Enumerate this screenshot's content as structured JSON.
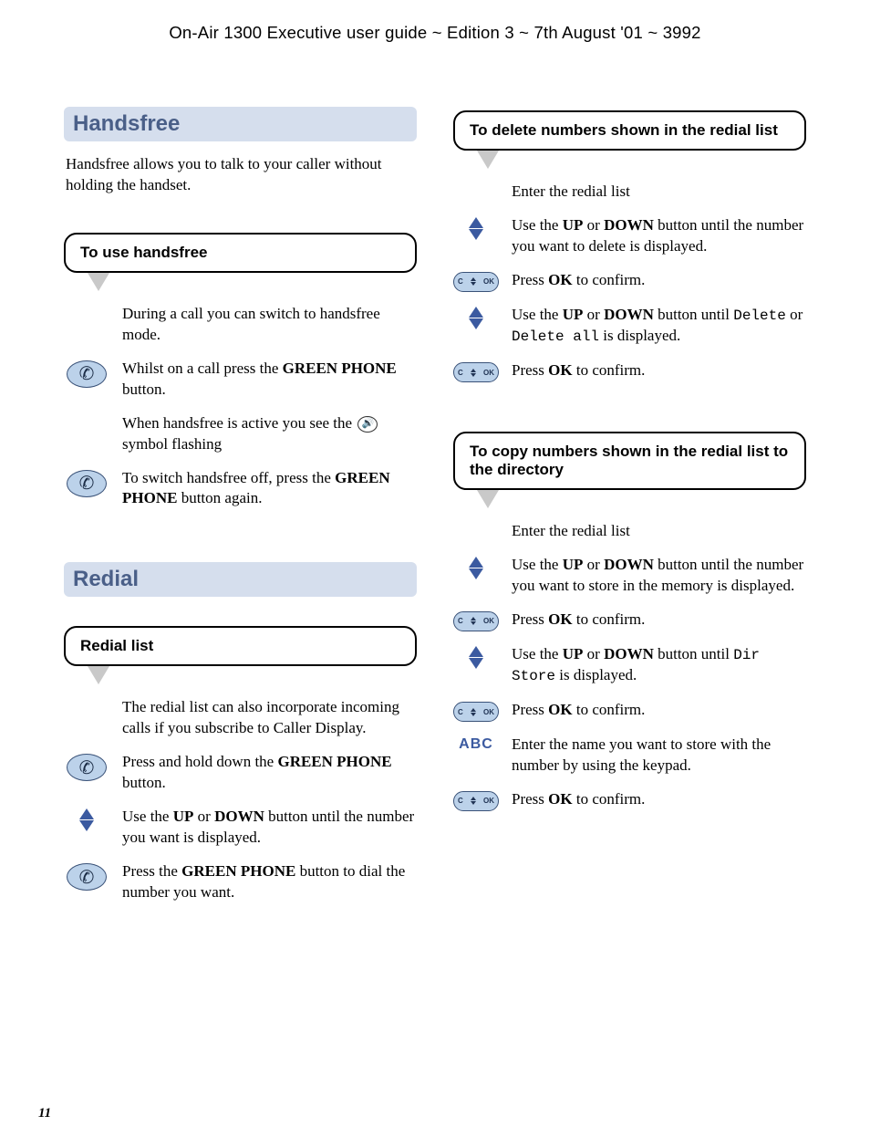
{
  "header": "On-Air 1300 Executive user guide ~ Edition 3 ~ 7th August '01 ~ 3992",
  "page_number": "11",
  "left": {
    "section1_title": "Handsfree",
    "section1_intro": "Handsfree allows you to talk to your caller without holding the handset.",
    "callout1_title": "To use handsfree",
    "c1_step1": "During a call you can switch to handsfree mode.",
    "c1_step2_pre": "Whilst on a call press the ",
    "c1_step2_bold": "GREEN PHONE",
    "c1_step2_post": " button.",
    "c1_step3_pre": "When handsfree is active you see the ",
    "c1_step3_post": " symbol flashing",
    "c1_step4_pre": "To switch handsfree off, press the ",
    "c1_step4_bold": "GREEN PHONE",
    "c1_step4_post": " button again.",
    "section2_title": "Redial",
    "callout2_title": "Redial list",
    "c2_step1": "The redial list can also incorporate incoming calls if you subscribe to Caller Display.",
    "c2_step2_pre": "Press and hold down the ",
    "c2_step2_bold": "GREEN PHONE",
    "c2_step2_post": " button.",
    "c2_step3_pre": "Use the ",
    "c2_step3_b1": "UP",
    "c2_step3_mid": " or ",
    "c2_step3_b2": "DOWN",
    "c2_step3_post": " button until the number you want is displayed.",
    "c2_step4_pre": "Press the ",
    "c2_step4_bold": "GREEN PHONE",
    "c2_step4_post": " button to dial the number you want."
  },
  "right": {
    "callout3_title": "To delete numbers shown in the redial list",
    "c3_step1": "Enter the redial list",
    "c3_step2_pre": "Use the ",
    "c3_step2_b1": "UP",
    "c3_step2_mid": " or ",
    "c3_step2_b2": "DOWN",
    "c3_step2_post": " button until the number you want to delete  is displayed.",
    "c3_step3_pre": "Press ",
    "c3_step3_bold": "OK",
    "c3_step3_post": " to confirm.",
    "c3_step4_pre": "Use the ",
    "c3_step4_b1": "UP",
    "c3_step4_mid": " or ",
    "c3_step4_b2": "DOWN",
    "c3_step4_mid2": " button until ",
    "c3_step4_m1": "Delete",
    "c3_step4_or": " or ",
    "c3_step4_m2": "Delete all",
    "c3_step4_post": " is displayed.",
    "c3_step5_pre": "Press ",
    "c3_step5_bold": "OK",
    "c3_step5_post": " to confirm.",
    "callout4_title": "To copy numbers shown in the redial list to the directory",
    "c4_step1": "Enter the redial list",
    "c4_step2_pre": "Use the ",
    "c4_step2_b1": "UP",
    "c4_step2_mid": " or ",
    "c4_step2_b2": "DOWN",
    "c4_step2_post": " button until the number you want to store in the memory is displayed.",
    "c4_step3_pre": "Press ",
    "c4_step3_bold": "OK",
    "c4_step3_post": " to confirm.",
    "c4_step4_pre": "Use the ",
    "c4_step4_b1": "UP",
    "c4_step4_mid": " or ",
    "c4_step4_b2": "DOWN",
    "c4_step4_mid2": " button until ",
    "c4_step4_m1": "Dir Store",
    "c4_step4_post": " is displayed.",
    "c4_step5_pre": "Press ",
    "c4_step5_bold": "OK",
    "c4_step5_post": " to confirm.",
    "c4_step6": "Enter the name you want to store with the number by using the keypad.",
    "c4_step7_pre": "Press ",
    "c4_step7_bold": "OK",
    "c4_step7_post": " to confirm.",
    "abc_label": "ABC"
  }
}
